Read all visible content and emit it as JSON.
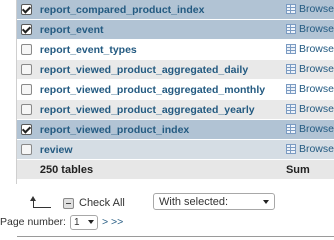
{
  "tables": [
    {
      "name": "report_compared_product_index",
      "checked": true,
      "style": "row-checked",
      "browse_label": "Browse"
    },
    {
      "name": "report_event",
      "checked": true,
      "style": "row-checked",
      "browse_label": "Browse"
    },
    {
      "name": "report_event_types",
      "checked": false,
      "style": "row-white",
      "browse_label": "Browse"
    },
    {
      "name": "report_viewed_product_aggregated_daily",
      "checked": false,
      "style": "row-light",
      "browse_label": "Browse"
    },
    {
      "name": "report_viewed_product_aggregated_monthly",
      "checked": false,
      "style": "row-white",
      "browse_label": "Browse"
    },
    {
      "name": "report_viewed_product_aggregated_yearly",
      "checked": false,
      "style": "row-light",
      "browse_label": "Browse"
    },
    {
      "name": "report_viewed_product_index",
      "checked": true,
      "style": "row-checked",
      "browse_label": "Browse"
    },
    {
      "name": "review",
      "checked": false,
      "style": "row-dark",
      "browse_label": "Browse"
    }
  ],
  "footer": {
    "count_label": "250 tables",
    "sum_label": "Sum"
  },
  "actions": {
    "check_all_label": "Check All",
    "with_selected_value": "With selected:"
  },
  "pager": {
    "label": "Page number:",
    "current_page": "1",
    "nav_label": "> >>"
  },
  "colors": {
    "link": "#235a81",
    "row_checked": "#b1c3d4",
    "row_light": "#e9e9e9"
  },
  "icons": {
    "browse": "table-grid-icon",
    "select_arrow": "corner-arrow-icon"
  }
}
